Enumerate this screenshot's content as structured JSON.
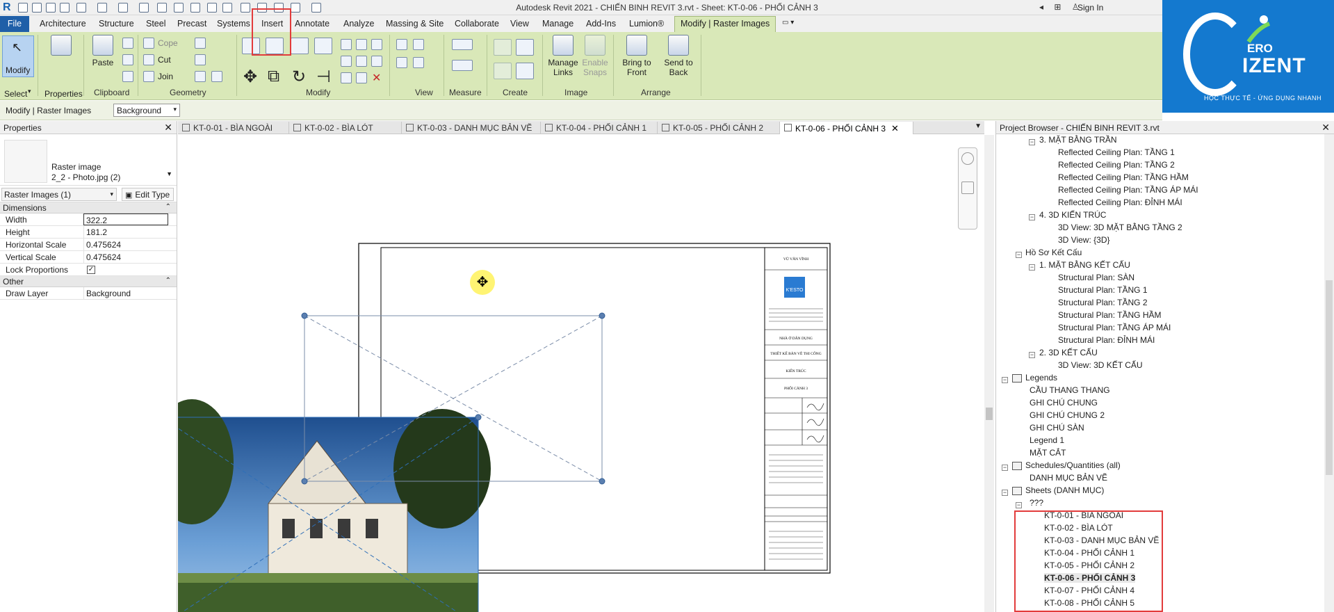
{
  "window": {
    "title": "Autodesk Revit 2021 - CHIẾN BINH REVIT 3.rvt - Sheet: KT-0-06 - PHỐI CẢNH 3",
    "app_logo": "R",
    "sign_in": "Sign In"
  },
  "ribbon": {
    "file": "File",
    "tabs": [
      "Architecture",
      "Structure",
      "Steel",
      "Precast",
      "Systems",
      "Insert",
      "Annotate",
      "Analyze",
      "Massing & Site",
      "Collaborate",
      "View",
      "Manage",
      "Add-Ins",
      "Lumion®"
    ],
    "active_tab": "Modify | Raster Images",
    "buttons": {
      "modify": "Modify",
      "properties": "Properties",
      "paste": "Paste",
      "cope": "Cope",
      "cut": "Cut",
      "join": "Join",
      "manage_links_1": "Manage",
      "manage_links_2": "Links",
      "enable_snaps_1": "Enable",
      "enable_snaps_2": "Snaps",
      "bring_front_1": "Bring to",
      "bring_front_2": "Front",
      "send_back_1": "Send to",
      "send_back_2": "Back"
    },
    "panels": {
      "select": "Select",
      "properties": "Properties",
      "clipboard": "Clipboard",
      "geometry": "Geometry",
      "modify": "Modify",
      "view": "View",
      "measure": "Measure",
      "create": "Create",
      "image": "Image",
      "arrange": "Arrange"
    },
    "highlight_color": "#e23b3b"
  },
  "options_bar": {
    "title": "Modify | Raster Images",
    "draw_layer": "Background"
  },
  "brand": {
    "ero": "ERO",
    "izent": "IZENT",
    "tagline": "HỌC THỰC TẾ - ỨNG DỤNG NHANH",
    "color": "#1479cf"
  },
  "properties": {
    "header": "Properties",
    "type_name_1": "Raster image",
    "type_name_2": "2_2 - Photo.jpg (2)",
    "filter": "Raster Images (1)",
    "edit_type": "Edit Type",
    "groups": {
      "dimensions": "Dimensions",
      "other": "Other"
    },
    "rows": {
      "width": {
        "k": "Width",
        "v": "322.2"
      },
      "height": {
        "k": "Height",
        "v": "181.2"
      },
      "hscale": {
        "k": "Horizontal Scale",
        "v": "0.475624"
      },
      "vscale": {
        "k": "Vertical Scale",
        "v": "0.475624"
      },
      "lock": {
        "k": "Lock Proportions",
        "v": "✓"
      },
      "draw_layer": {
        "k": "Draw Layer",
        "v": "Background"
      }
    }
  },
  "view_tabs": [
    "KT-0-01 - BÌA NGOÀI",
    "KT-0-02 - BÌA LÓT",
    "KT-0-03 - DANH MỤC BẢN VẼ",
    "KT-0-04 - PHỐI CẢNH 1",
    "KT-0-05 - PHỐI CẢNH 2",
    "KT-0-06 - PHỐI CẢNH 3"
  ],
  "title_block": {
    "designer": "VŨ VĂN VĨNH",
    "project": "NHÀ Ở DÂN DỤNG",
    "stage": "THIẾT KẾ BẢN VẼ THI CÔNG",
    "discipline": "KIẾN TRÚC",
    "sheet_name": "PHỐI CẢNH 3",
    "company": "K'ESTO"
  },
  "browser": {
    "header": "Project Browser - CHIẾN BINH REVIT 3.rvt",
    "items": {
      "ceiling_group": "3. MẶT BẰNG TRẦN",
      "rcp1": "Reflected Ceiling Plan: TẦNG 1",
      "rcp2": "Reflected Ceiling Plan: TẦNG 2",
      "rcp3": "Reflected Ceiling Plan: TẦNG HẦM",
      "rcp4": "Reflected Ceiling Plan: TẦNG ÁP MÁI",
      "rcp5": "Reflected Ceiling Plan: ĐỈNH MÁI",
      "arch3d_group": "4. 3D KIẾN TRÚC",
      "v3d1": "3D View: 3D MẶT BẰNG TẦNG 2",
      "v3d2": "3D View: {3D}",
      "struct_root": "Hồ Sơ Kết Cấu",
      "struct_group": "1. MẶT BẰNG KẾT CẤU",
      "sp1": "Structural Plan: SÀN",
      "sp2": "Structural Plan: TẦNG 1",
      "sp3": "Structural Plan: TẦNG 2",
      "sp4": "Structural Plan: TẦNG HẦM",
      "sp5": "Structural Plan: TẦNG ÁP MÁI",
      "sp6": "Structural Plan: ĐỈNH MÁI",
      "struct3d_group": "2. 3D KẾT CẤU",
      "s3d": "3D View: 3D KẾT CẤU",
      "legends": "Legends",
      "lg1": "CẦU THANG THANG",
      "lg2": "GHI CHÚ CHUNG",
      "lg3": "GHI CHÚ CHUNG 2",
      "lg4": "GHI CHÚ SÀN",
      "lg5": "Legend 1",
      "lg6": "MẶT CẮT",
      "schedules": "Schedules/Quantities (all)",
      "sch1": "DANH MỤC BẢN VẼ",
      "sheets": "Sheets (DANH MỤC)",
      "sheets_sub": "???",
      "sh1": "KT-0-01 - BÌA NGOÀI",
      "sh2": "KT-0-02 - BÌA LÓT",
      "sh3": "KT-0-03 - DANH MỤC BẢN VẼ",
      "sh4": "KT-0-04 - PHỐI CẢNH 1",
      "sh5": "KT-0-05 - PHỐI CẢNH 2",
      "sh6": "KT-0-06 - PHỐI CẢNH 3",
      "sh7": "KT-0-07 - PHỐI CẢNH 4",
      "sh8": "KT-0-08 - PHỐI CẢNH 5"
    }
  }
}
